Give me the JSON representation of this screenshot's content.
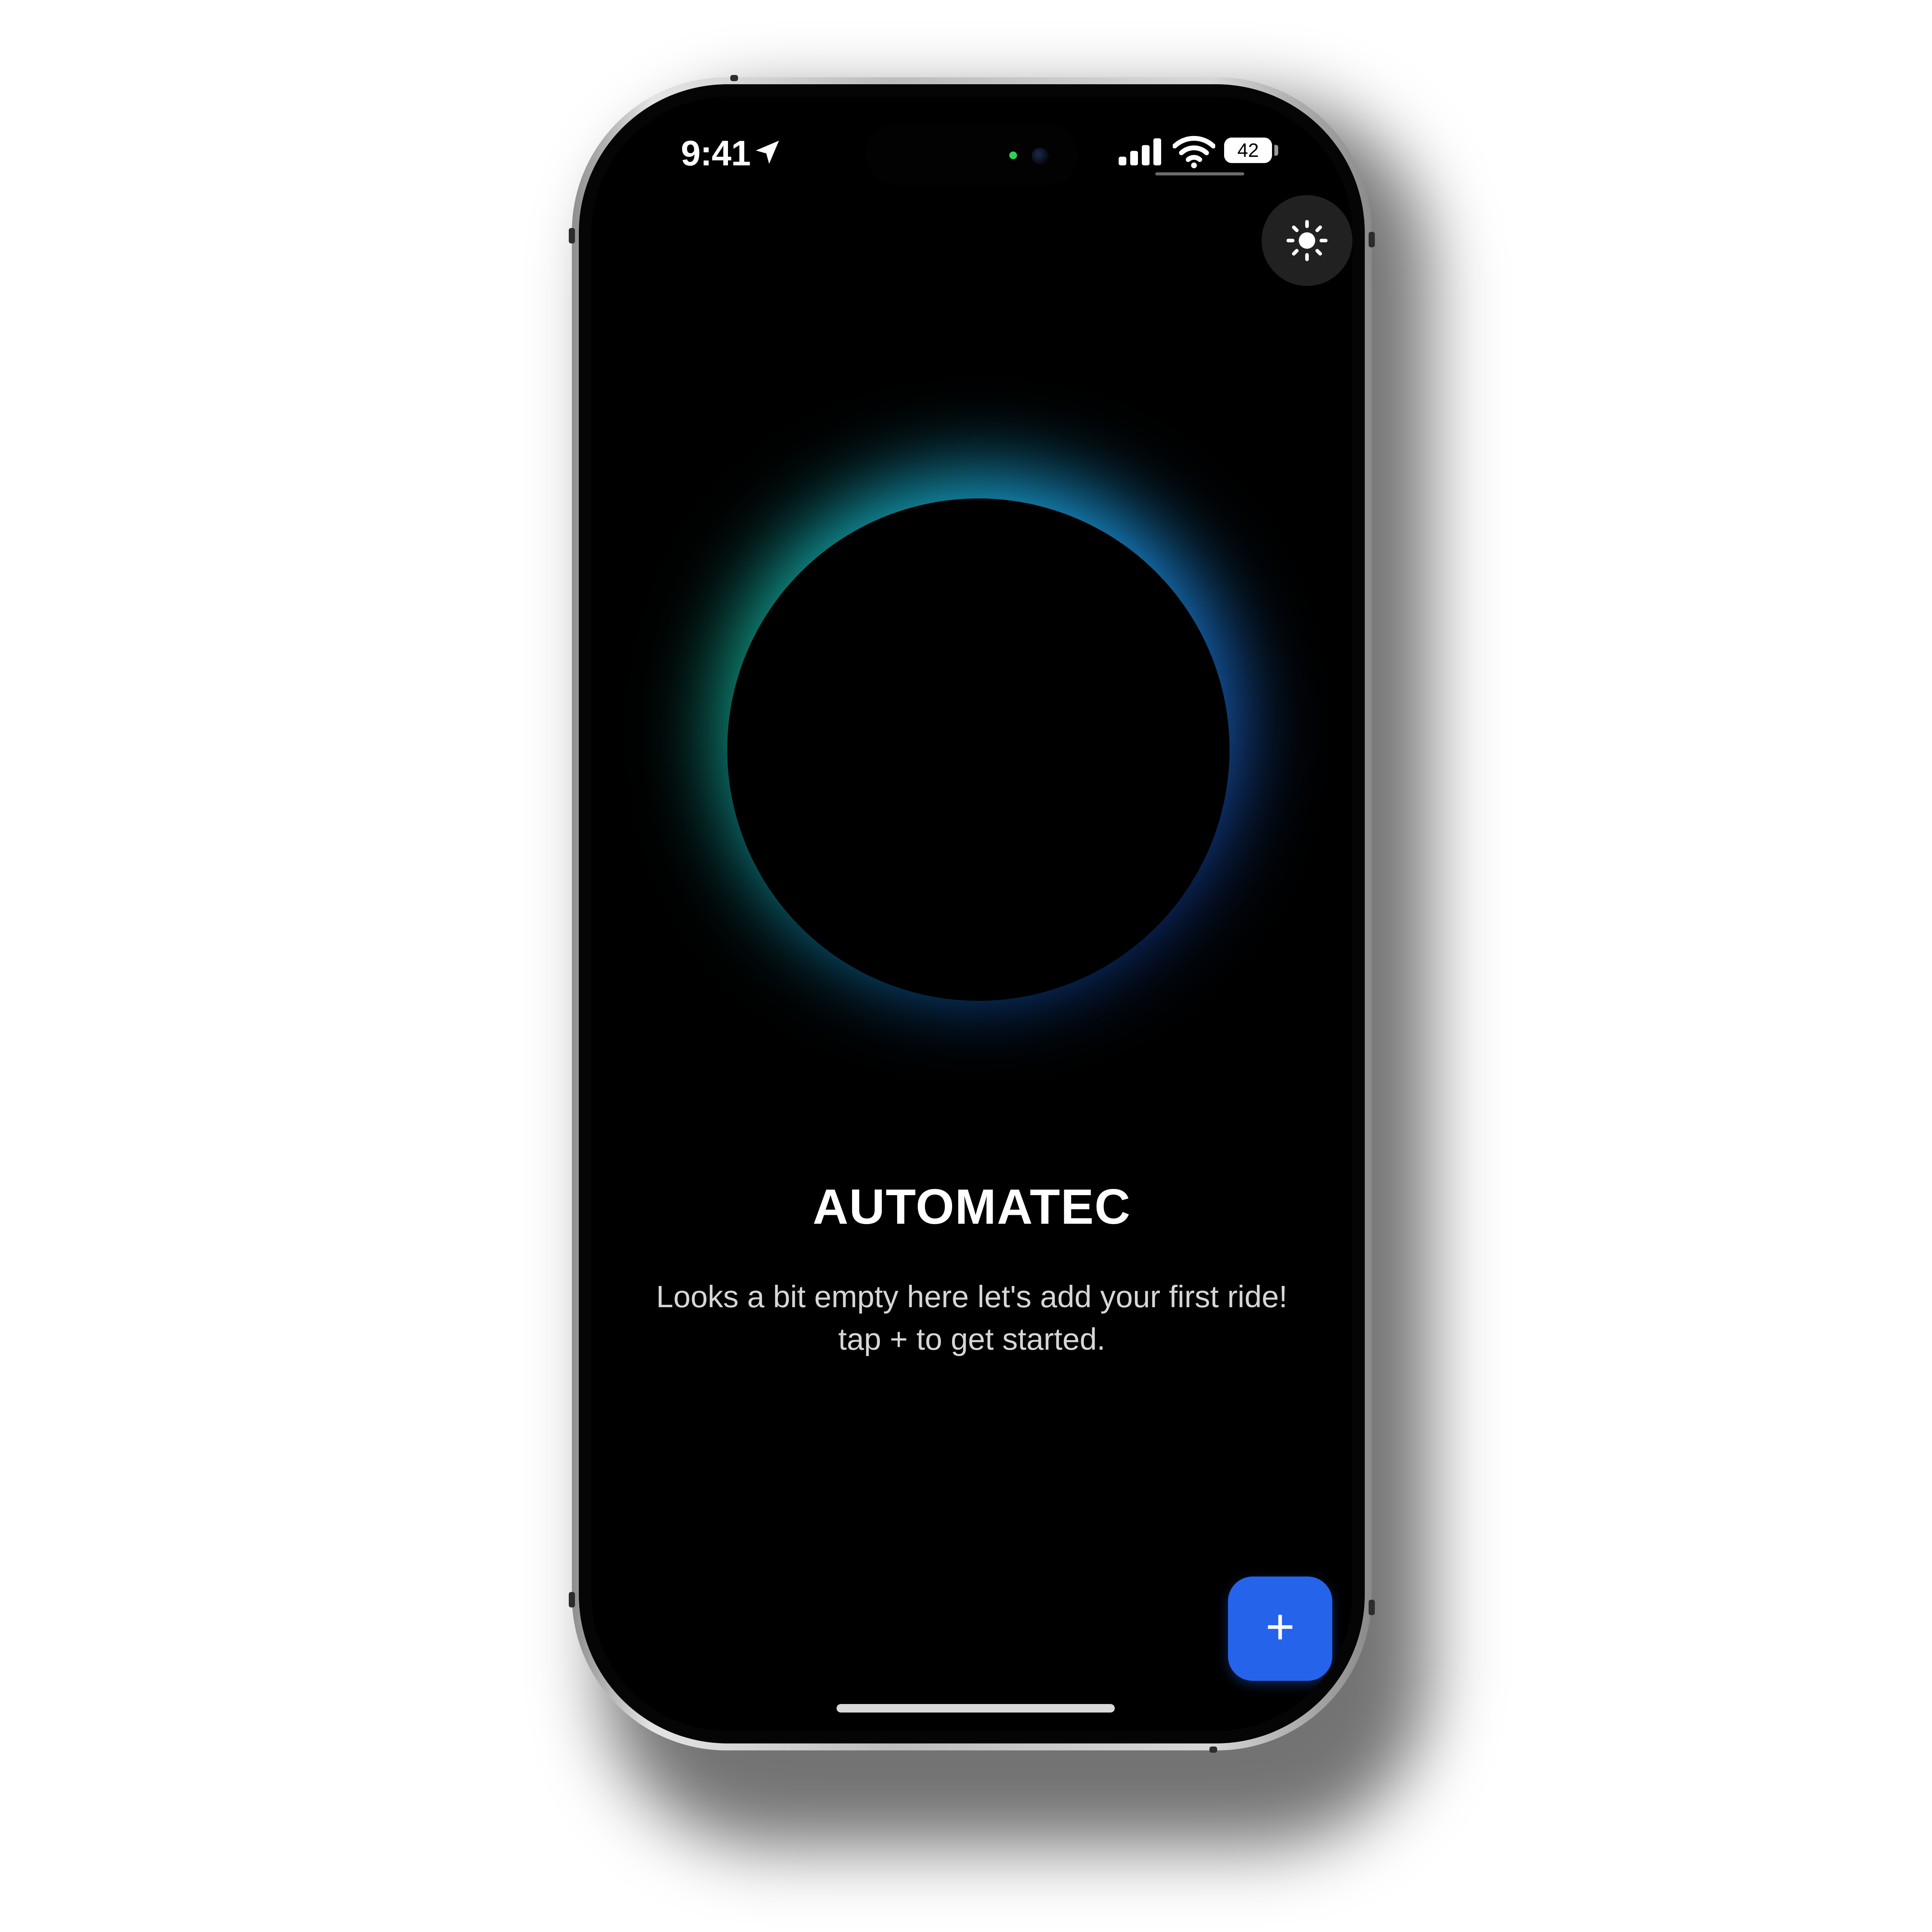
{
  "status_bar": {
    "time": "9:41",
    "battery": "42",
    "battery_level": 0.42
  },
  "header": {
    "theme_toggle_icon": "sun-icon"
  },
  "hero": {
    "accent_colors": [
      "#13b89a",
      "#1aa0e8",
      "#1d6ed6"
    ]
  },
  "main": {
    "title": "AUTOMATEC",
    "message_line1": "Looks a bit empty here let's add your first ride!",
    "message_line2": "tap + to get started."
  },
  "fab": {
    "label": "+",
    "color": "#2563eb"
  }
}
